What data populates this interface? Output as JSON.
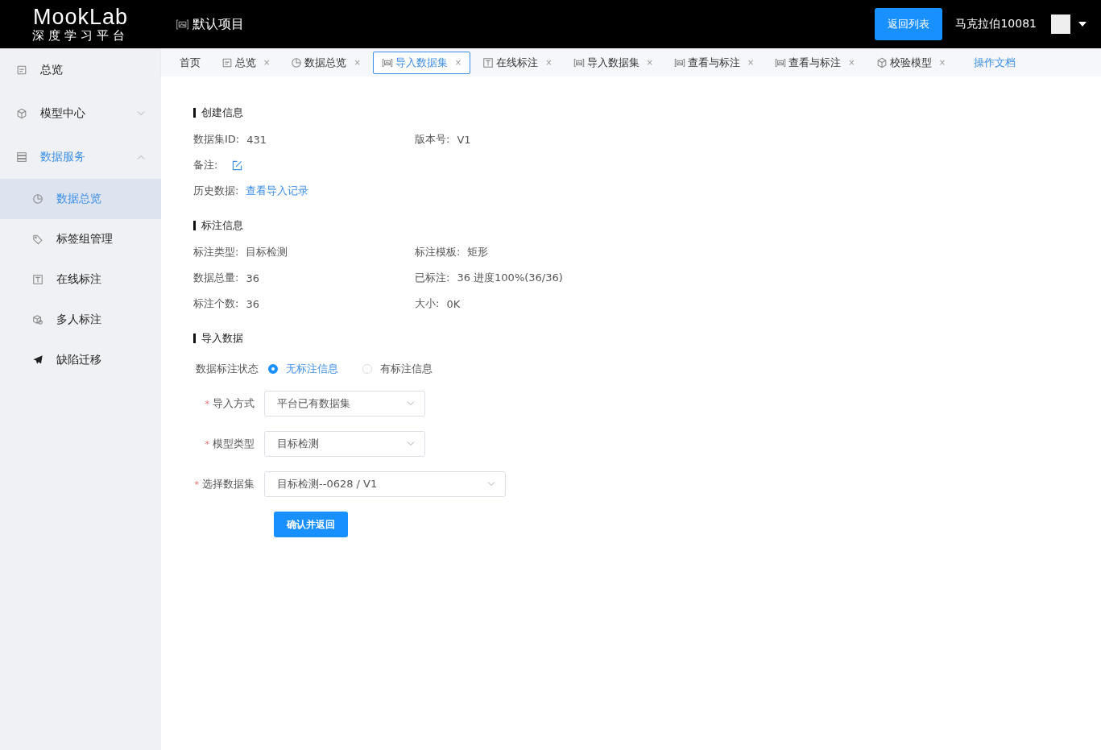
{
  "header": {
    "logo": "MookLab",
    "subtitle": "深度学习平台",
    "project": "默认项目",
    "back_button": "返回列表",
    "user": "马克拉伯10081"
  },
  "sidebar": {
    "items": [
      {
        "kind": "overview",
        "label": "总览",
        "selected": false
      },
      {
        "kind": "cube",
        "label": "模型中心",
        "selected": false,
        "expanded": false
      },
      {
        "kind": "server",
        "label": "数据服务",
        "selected": false,
        "expanded": true,
        "children": [
          {
            "kind": "chart",
            "label": "数据总览",
            "selected": true
          },
          {
            "kind": "tag",
            "label": "标签组管理",
            "selected": false
          },
          {
            "kind": "text",
            "label": "在线标注",
            "selected": false
          },
          {
            "kind": "cubes",
            "label": "多人标注",
            "selected": false
          },
          {
            "kind": "plane",
            "label": "缺陷迁移",
            "selected": false
          }
        ]
      }
    ]
  },
  "tabs": [
    {
      "kind": "plain",
      "label": "首页",
      "selected": false
    },
    {
      "kind": "overview",
      "label": "总览",
      "selected": false,
      "close": "×"
    },
    {
      "kind": "chart",
      "label": "数据总览",
      "selected": false,
      "close": "×"
    },
    {
      "kind": "dataset",
      "label": "导入数据集",
      "selected": true,
      "close": "×"
    },
    {
      "kind": "text",
      "label": "在线标注",
      "selected": false,
      "close": "×"
    },
    {
      "kind": "dataset",
      "label": "导入数据集",
      "selected": false,
      "close": "×"
    },
    {
      "kind": "dataset",
      "label": "查看与标注",
      "selected": false,
      "close": "×"
    },
    {
      "kind": "dataset",
      "label": "查看与标注",
      "selected": false,
      "close": "×"
    },
    {
      "kind": "cube",
      "label": "校验模型",
      "selected": false,
      "close": "×"
    },
    {
      "kind": "link",
      "label": "操作文档",
      "selected": false
    }
  ],
  "sections": [
    {
      "title": "创建信息",
      "fields": [
        {
          "kind": "text",
          "label": "数据集ID:",
          "value": "431"
        },
        {
          "kind": "text",
          "label": "版本号:",
          "value": "V1"
        },
        {
          "kind": "edit",
          "label": "备注:"
        },
        {
          "kind": "blank"
        },
        {
          "kind": "link",
          "label": "历史数据:",
          "value": "查看导入记录"
        }
      ]
    },
    {
      "title": "标注信息",
      "fields": [
        {
          "kind": "text",
          "label": "标注类型:",
          "value": "目标检测"
        },
        {
          "kind": "text",
          "label": "标注模板:",
          "value": "矩形"
        },
        {
          "kind": "text",
          "label": "数据总量:",
          "value": "36"
        },
        {
          "kind": "text",
          "label": "已标注:",
          "value": "36 进度100%(36/36)"
        },
        {
          "kind": "text",
          "label": "标注个数:",
          "value": "36"
        },
        {
          "kind": "text",
          "label": "大小:",
          "value": "0K"
        }
      ]
    },
    {
      "title": "导入数据"
    }
  ],
  "form": {
    "radio_label": "数据标注状态",
    "radio_options": [
      {
        "label": "无标注信息",
        "selected": true
      },
      {
        "label": "有标注信息",
        "selected": false
      }
    ],
    "selects": [
      {
        "label": "导入方式",
        "required_mark": "*",
        "value": "平台已有数据集",
        "wide": false
      },
      {
        "label": "模型类型",
        "required_mark": "*",
        "value": "目标检测",
        "wide": false
      },
      {
        "label": "选择数据集",
        "required_mark": "*",
        "value": "目标检测--0628 / V1",
        "wide": true
      }
    ],
    "submit": "确认并返回"
  }
}
